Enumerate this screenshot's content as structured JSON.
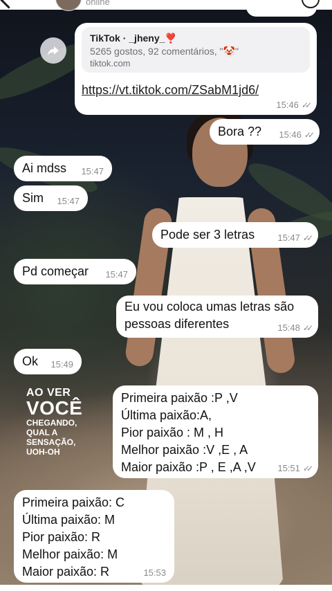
{
  "header": {
    "status": "online"
  },
  "link_message": {
    "preview_title_prefix": "TikTok · _jheny_",
    "preview_title_emoji": "❣️",
    "preview_description": "5265 gostos, 92 comentários, \"🤡\"",
    "preview_domain": "tiktok.com",
    "url": "https://vt.tiktok.com/ZSabM1jd6/",
    "time": "15:46",
    "ticks": "✓✓"
  },
  "messages": [
    {
      "text": "Bora ??",
      "time": "15:46",
      "ticks": "✓✓",
      "from": "me"
    },
    {
      "text": "Ai mdss",
      "time": "15:47",
      "from": "them"
    },
    {
      "text": "Sim",
      "time": "15:47",
      "from": "them"
    },
    {
      "text": "Pode ser 3 letras",
      "time": "15:47",
      "ticks": "✓✓",
      "from": "me"
    },
    {
      "text": "Pd começar",
      "time": "15:47",
      "from": "them"
    },
    {
      "text": "Eu vou coloca umas letras são\npessoas diferentes",
      "time": "15:48",
      "ticks": "✓✓",
      "from": "me"
    },
    {
      "text": "Ok",
      "time": "15:49",
      "from": "them"
    },
    {
      "text": "Primeira paixão :P ,V\nÚltima paixão:A,\nPior paixão : M , H\nMelhor paixão :V ,E , A\nMaior paixão :P , E ,A ,V",
      "time": "15:51",
      "ticks": "✓✓",
      "from": "me"
    },
    {
      "text": "Primeira paixão: C\nÚltima paixão: M\nPior paixão: R\nMelhor paixão: M\nMaior paixão: R",
      "time": "15:53",
      "from": "them"
    }
  ],
  "sticker": {
    "line1": "AO VER",
    "line2": "VOCÊ",
    "line3": "CHEGANDO,",
    "line4": "QUAL A",
    "line5": "SENSAÇÃO,",
    "line6": "UOH-OH"
  },
  "icons": {
    "share": "share-forward-icon",
    "read_receipt": "double-check-icon"
  },
  "colors": {
    "bubble": "#ffffff",
    "meta_text": "#8a8a8e",
    "heart": "#d21f3c"
  }
}
